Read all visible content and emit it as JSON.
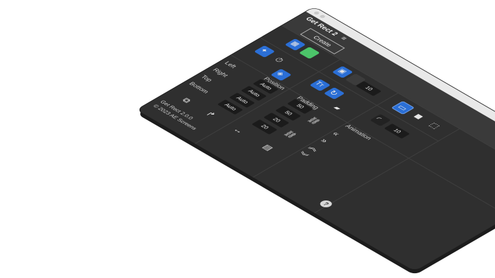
{
  "window": {
    "title": "Get Rect 2"
  },
  "toolbar": {
    "create_label": "Create",
    "menu_icon": "hamburger-menu-icon"
  },
  "shape": {
    "stroke_width": "10",
    "corner_radius": "10"
  },
  "sides": {
    "left_label": "Left",
    "right_label": "Right",
    "top_label": "Top",
    "bottom_label": "Bottom"
  },
  "position": {
    "label": "Position",
    "left": "Auto",
    "right": "Auto",
    "top": "Auto",
    "bottom": "Auto"
  },
  "padding": {
    "label": "Padding",
    "left": "50",
    "right": "50",
    "top": "20",
    "bottom": "20"
  },
  "animation": {
    "label": "Animation"
  },
  "footer": {
    "version": "Get Rect 2.0.0",
    "copyright": "© 2023 AE Screens",
    "help_label": "?"
  },
  "colors": {
    "panel": "#2f2f2f",
    "accent_blue": "#2b6fd6",
    "fill_green": "#4cc46a",
    "titlebar": "#e9e9e9"
  }
}
